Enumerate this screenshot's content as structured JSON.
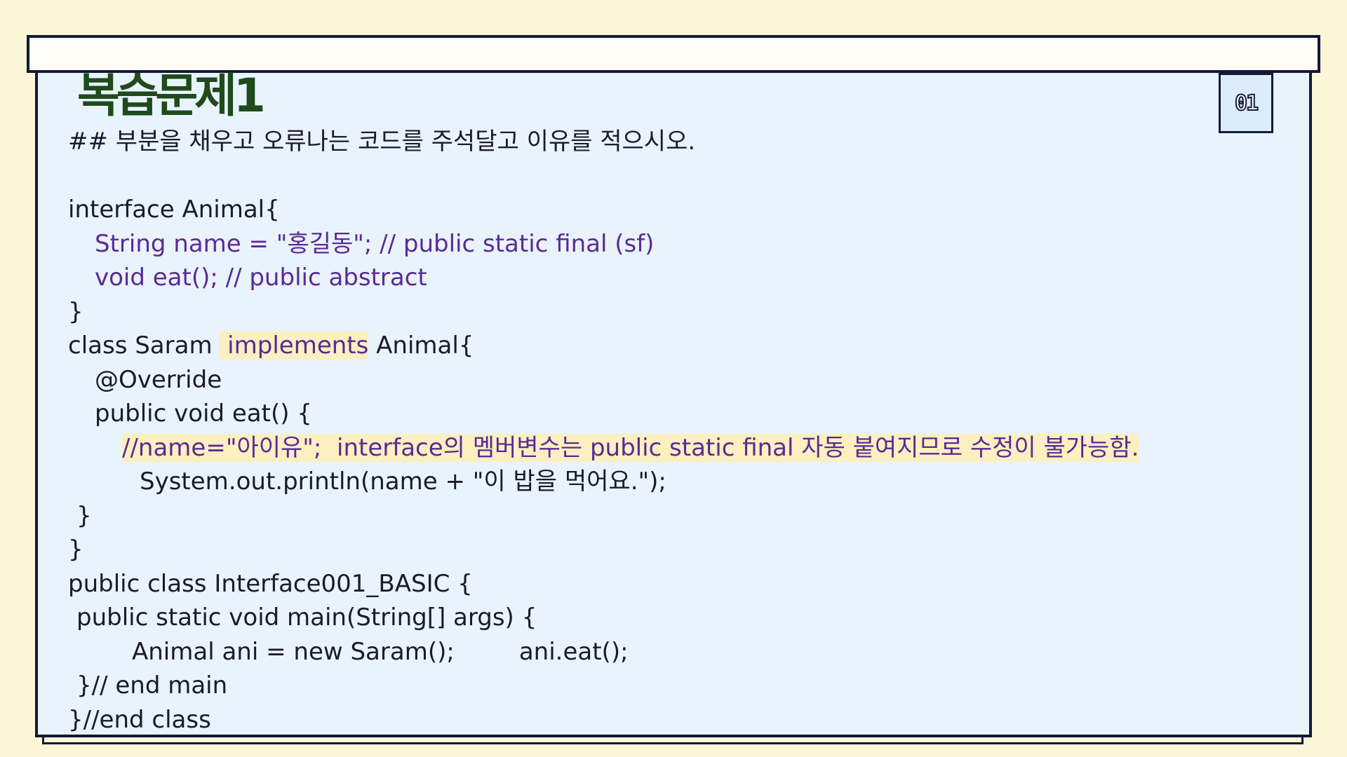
{
  "title": "복습문제1",
  "badge": "01",
  "instruction": "## 부분을 채우고 오류나는 코드를 주석달고 이유를 적으시오.",
  "code": {
    "l1": "interface Animal{",
    "l2": "String name = \"홍길동\"; // public static final (sf)",
    "l3": "void eat(); // public abstract",
    "l4": "}",
    "l5a": "class Saram ",
    "l5b": " implements",
    "l5c": " Animal{",
    "l6": "@Override",
    "l7": "public void eat() {",
    "l8": "//name=\"아이유\";  interface의 멤버변수는 public static final 자동 붙여지므로 수정이 불가능함.",
    "l9": "System.out.println(name + \"이 밥을 먹어요.\");",
    "l10": "}",
    "l11": "}",
    "l12": "public class Interface001_BASIC {",
    "l13": "public static void main(String[] args) {",
    "l14a": "Animal ani = new Saram();",
    "l14b": "ani.eat();",
    "l15": "}// end main",
    "l16": "}//end class"
  },
  "colors": {
    "background": "#fdf7d9",
    "panel": "#e9f3fb",
    "border": "#111a38",
    "title": "#1e4a1c",
    "comment": "#5a2a96",
    "highlight": "#fcefc0"
  }
}
